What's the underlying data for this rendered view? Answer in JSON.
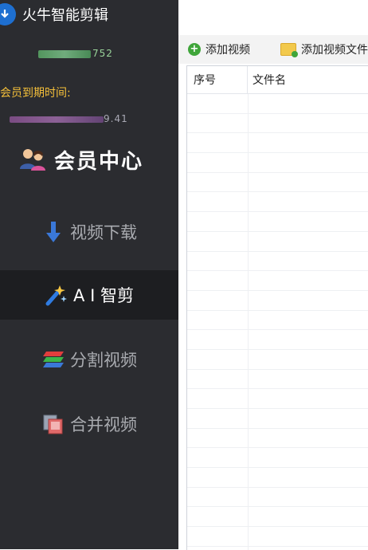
{
  "app": {
    "title": "火牛智能剪辑"
  },
  "user": {
    "id_suffix": "752",
    "member_label": "会员到期时间:",
    "member_time_suffix": "9.41"
  },
  "member_center": {
    "label": "会员中心"
  },
  "nav": [
    {
      "label": "视频下载",
      "icon": "download-arrow-icon",
      "active": false
    },
    {
      "label": "A I 智剪",
      "icon": "magic-wand-icon",
      "active": true
    },
    {
      "label": "分割视频",
      "icon": "split-layers-icon",
      "active": false
    },
    {
      "label": "合并视频",
      "icon": "merge-frames-icon",
      "active": false
    }
  ],
  "toolbar": {
    "add_video": "添加视频",
    "add_folder": "添加视频文件"
  },
  "table": {
    "columns": [
      "序号",
      "文件名"
    ]
  },
  "colors": {
    "sidebar_bg": "#2b2c30",
    "active_bg": "#1d1e21",
    "member_label": "#f5c03a",
    "add_green": "#3fa53a"
  }
}
